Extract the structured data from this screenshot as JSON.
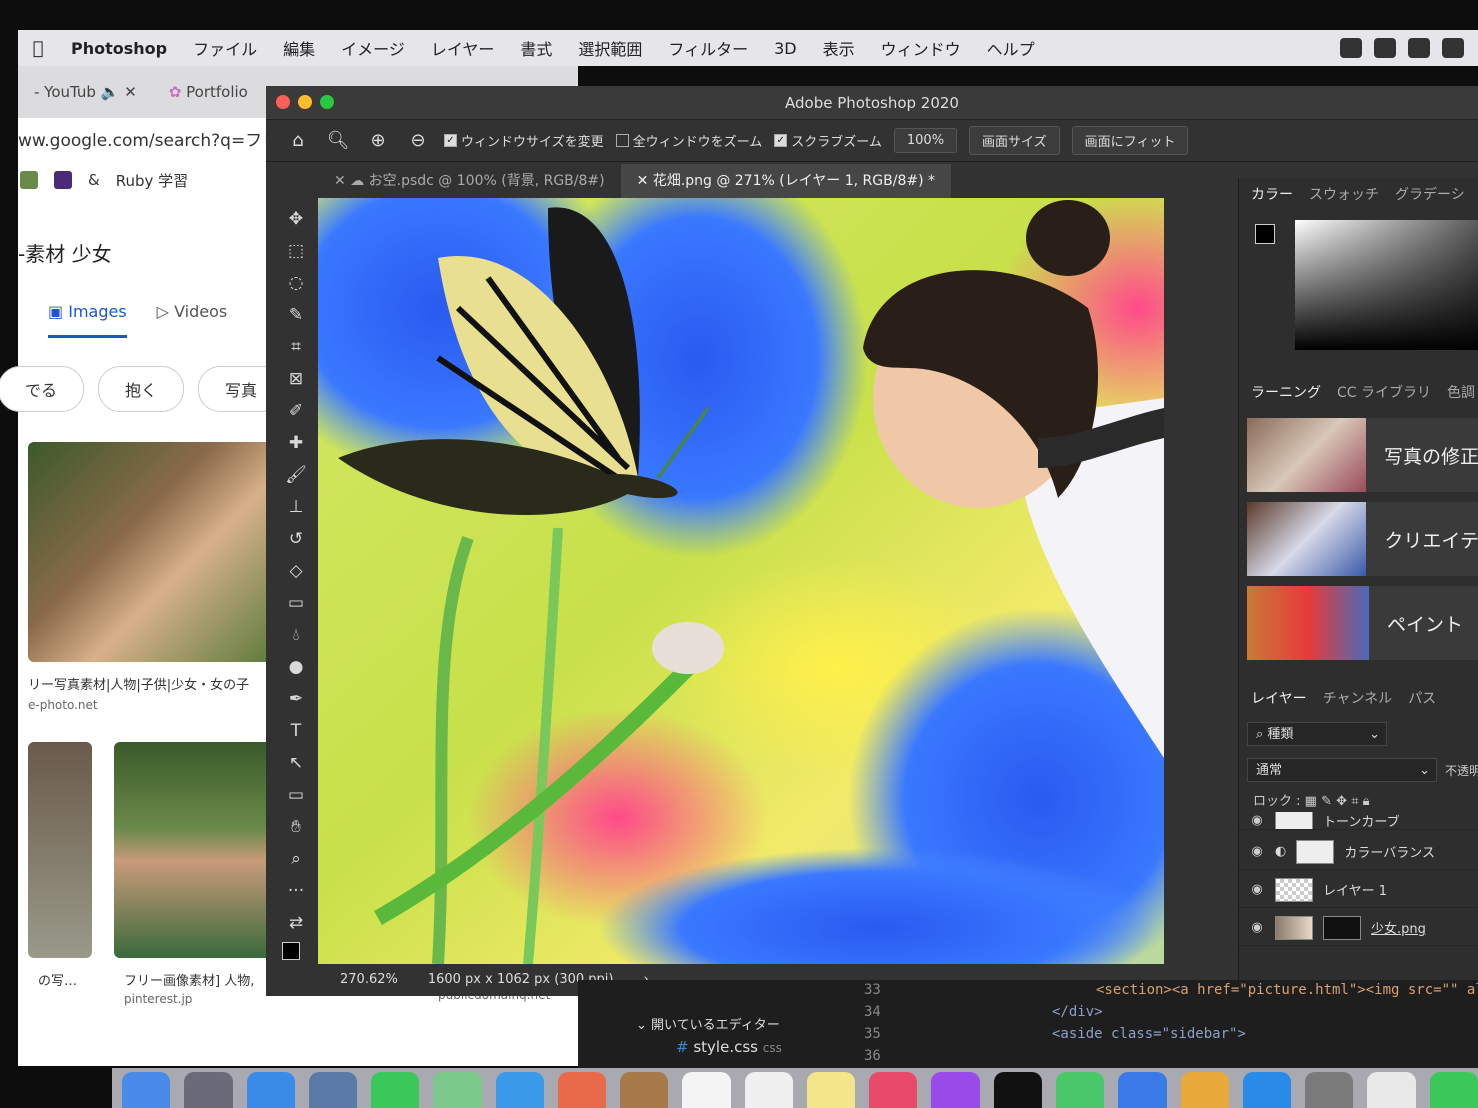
{
  "menubar": {
    "app_name": "Photoshop",
    "items": [
      "ファイル",
      "編集",
      "イメージ",
      "レイヤー",
      "書式",
      "選択範囲",
      "フィルター",
      "3D",
      "表示",
      "ウィンドウ",
      "ヘルプ"
    ]
  },
  "browser": {
    "tabs": [
      "- YouTub",
      "Portfolio"
    ],
    "url": "ww.google.com/search?q=フリ",
    "bookmarks": [
      "&",
      "Ruby 学習"
    ],
    "query": "-素材 少女",
    "search_tabs": [
      "Images",
      "Videos"
    ],
    "chips": [
      "でる",
      "抱く",
      "写真"
    ],
    "results": [
      {
        "caption": "リー写真素材|人物|子供|少女・女の子",
        "source": "e-photo.net"
      },
      {
        "caption": "の写…",
        "source": ""
      },
      {
        "caption": "フリー画像素材] 人物, ",
        "source": "pinterest.jp"
      },
      {
        "caption": "",
        "source": "publicdomainq.net"
      }
    ]
  },
  "photoshop": {
    "window_title": "Adobe Photoshop 2020",
    "options": {
      "resize_windows": "ウィンドウサイズを変更",
      "zoom_all": "全ウィンドウをズーム",
      "scrubby_zoom": "スクラブズーム",
      "zoom_level": "100%",
      "fit_screen": "画面サイズ",
      "fill_screen": "画面にフィット"
    },
    "doc_tabs": [
      {
        "label": "お空.psdc @ 100% (背景, RGB/8#)",
        "active": false
      },
      {
        "label": "花畑.png @ 271% (レイヤー 1, RGB/8#) *",
        "active": true
      }
    ],
    "status": {
      "zoom": "270.62%",
      "doc_info": "1600 px x 1062 px (300 ppi)"
    },
    "panels": {
      "color_tabs": [
        "カラー",
        "スウォッチ",
        "グラデーシ"
      ],
      "learn_tabs": [
        "ラーニング",
        "CC ライブラリ",
        "色調"
      ],
      "learn_cards": [
        "写真の修正",
        "クリエイテ",
        "ペイント"
      ],
      "layer_tabs": [
        "レイヤー",
        "チャンネル",
        "パス"
      ],
      "filter_kind": "種類",
      "blend_mode": "通常",
      "opacity_label": "不透明",
      "lock_label": "ロック :",
      "layers": [
        "トーンカーブ",
        "カラーバランス",
        "レイヤー 1",
        "少女.png"
      ]
    }
  },
  "editor": {
    "line_numbers": [
      "33",
      "34",
      "35",
      "36"
    ],
    "explorer_label": "開いているエディター",
    "file": "style.css",
    "file_type": "css",
    "code_lines": [
      "<section><a href=\"picture.html\"><img src=\"\" al",
      "</div>",
      "<aside class=\"sidebar\">"
    ]
  }
}
